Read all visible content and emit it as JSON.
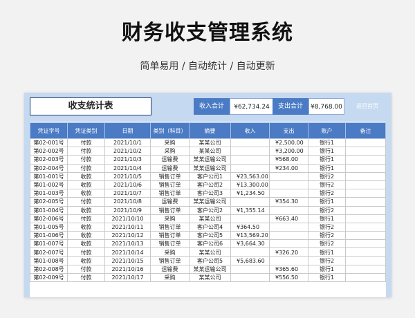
{
  "hero": {
    "title": "财务收支管理系统",
    "subtitle": "简单易用  /  自动统计  /  自动更新"
  },
  "sheet": {
    "title": "收支统计表",
    "income_label": "收入合计",
    "income_value": "¥62,734.24",
    "expense_label": "支出合计",
    "expense_value": "¥8,768.00",
    "back_label": "返回首页"
  },
  "table": {
    "columns": [
      "凭证字号",
      "凭证类别",
      "日期",
      "类别（科目）",
      "摘要",
      "收入",
      "支出",
      "账户",
      "备注"
    ],
    "rows": [
      [
        "第02-001号",
        "付款",
        "2021/10/1",
        "采购",
        "某某公司",
        "",
        "¥2,500.00",
        "银行1",
        ""
      ],
      [
        "第02-002号",
        "付款",
        "2021/10/2",
        "采购",
        "某某公司",
        "",
        "¥3,200.00",
        "银行1",
        ""
      ],
      [
        "第02-003号",
        "付款",
        "2021/10/3",
        "运输费",
        "某某运输公司",
        "",
        "¥568.00",
        "银行1",
        ""
      ],
      [
        "第02-004号",
        "付款",
        "2021/10/4",
        "运输费",
        "某某运输公司",
        "",
        "¥234.00",
        "银行1",
        ""
      ],
      [
        "第01-001号",
        "收款",
        "2021/10/5",
        "销售订单",
        "客户公司1",
        "¥23,563.00",
        "",
        "银行2",
        ""
      ],
      [
        "第01-002号",
        "收款",
        "2021/10/6",
        "销售订单",
        "客户公司2",
        "¥13,300.00",
        "",
        "银行2",
        ""
      ],
      [
        "第01-003号",
        "收款",
        "2021/10/7",
        "销售订单",
        "客户公司3",
        "¥1,234.50",
        "",
        "银行2",
        ""
      ],
      [
        "第02-005号",
        "付款",
        "2021/10/8",
        "运输费",
        "某某运输公司",
        "",
        "¥354.30",
        "银行1",
        ""
      ],
      [
        "第01-004号",
        "收款",
        "2021/10/9",
        "销售订单",
        "客户公司2",
        "¥1,355.14",
        "",
        "银行2",
        ""
      ],
      [
        "第02-006号",
        "付款",
        "2021/10/10",
        "采购",
        "某某公司",
        "",
        "¥663.40",
        "银行1",
        ""
      ],
      [
        "第01-005号",
        "收款",
        "2021/10/11",
        "销售订单",
        "客户公司4",
        "¥364.50",
        "",
        "银行2",
        ""
      ],
      [
        "第01-006号",
        "收款",
        "2021/10/12",
        "销售订单",
        "客户公司5",
        "¥13,569.20",
        "",
        "银行2",
        ""
      ],
      [
        "第01-007号",
        "收款",
        "2021/10/13",
        "销售订单",
        "客户公司6",
        "¥3,664.30",
        "",
        "银行2",
        ""
      ],
      [
        "第02-007号",
        "付款",
        "2021/10/14",
        "采购",
        "某某公司",
        "",
        "¥326.20",
        "银行1",
        ""
      ],
      [
        "第01-008号",
        "收款",
        "2021/10/15",
        "销售订单",
        "客户公司5",
        "¥5,683.60",
        "",
        "银行2",
        ""
      ],
      [
        "第02-008号",
        "付款",
        "2021/10/16",
        "运输费",
        "某某运输公司",
        "",
        "¥365.60",
        "银行1",
        ""
      ],
      [
        "第02-009号",
        "付款",
        "2021/10/17",
        "采购",
        "某某公司",
        "",
        "¥556.50",
        "银行1",
        ""
      ]
    ]
  },
  "colors": {
    "header_blue": "#4a7bc4",
    "band_blue": "#c5d9f1",
    "title_border": "#1f3864"
  }
}
